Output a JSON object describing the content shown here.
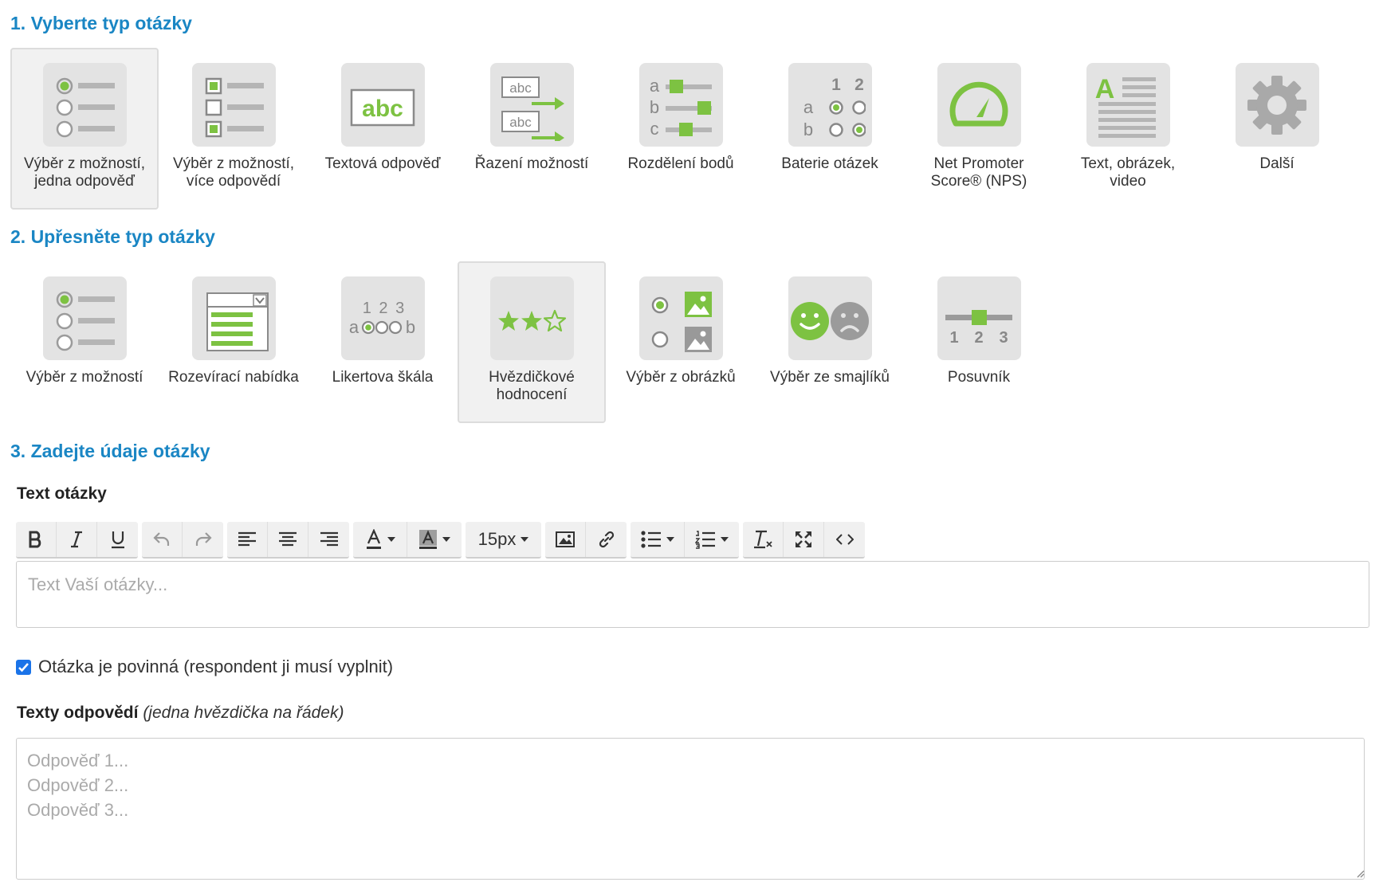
{
  "sections": {
    "s1": "1. Vyberte typ otázky",
    "s2": "2. Upřesněte typ otázky",
    "s3": "3. Zadejte údaje otázky"
  },
  "question_types": [
    {
      "label": "Výběr z možností,\njedna odpověď",
      "icon": "single-choice-icon",
      "selected": true
    },
    {
      "label": "Výběr z možností,\nvíce odpovědí",
      "icon": "multiple-choice-icon"
    },
    {
      "label": "Textová odpověď",
      "icon": "text-answer-icon"
    },
    {
      "label": "Řazení možností",
      "icon": "ordering-icon"
    },
    {
      "label": "Rozdělení bodů",
      "icon": "points-distribution-icon"
    },
    {
      "label": "Baterie otázek",
      "icon": "question-battery-icon"
    },
    {
      "label": "Net Promoter\nScore® (NPS)",
      "icon": "gauge-icon"
    },
    {
      "label": "Text, obrázek,\nvideo",
      "icon": "text-image-video-icon"
    },
    {
      "label": "Další",
      "icon": "gear-icon"
    }
  ],
  "subtypes": [
    {
      "label": "Výběr z možností",
      "icon": "radio-list-icon"
    },
    {
      "label": "Rozevírací nabídka",
      "icon": "dropdown-icon"
    },
    {
      "label": "Likertova škála",
      "icon": "likert-scale-icon"
    },
    {
      "label": "Hvězdičkové\nhodnocení",
      "icon": "star-rating-icon",
      "selected": true
    },
    {
      "label": "Výběr z obrázků",
      "icon": "image-choice-icon"
    },
    {
      "label": "Výběr ze smajlíků",
      "icon": "smiley-icon"
    },
    {
      "label": "Posuvník",
      "icon": "slider-icon"
    }
  ],
  "icon_texts": {
    "abc": "abc",
    "a": "a",
    "b": "b",
    "c": "c",
    "n1": "1",
    "n2": "2",
    "n3": "3",
    "likert_digits": "1 2 3",
    "A": "A"
  },
  "question_text": {
    "label": "Text otázky",
    "placeholder": "Text Vaší otázky...",
    "font_size": "15px"
  },
  "toolbar_buttons": [
    "bold-icon",
    "italic-icon",
    "underline-icon",
    "undo-icon",
    "redo-icon",
    "align-left-icon",
    "align-center-icon",
    "align-right-icon",
    "text-color-icon",
    "background-color-icon",
    "font-size-select",
    "image-icon",
    "link-icon",
    "bullet-list-icon",
    "numbered-list-icon",
    "clear-format-icon",
    "fullscreen-icon",
    "code-view-icon"
  ],
  "required": {
    "label": "Otázka je povinná (respondent ji musí vyplnit)",
    "checked": true
  },
  "answers": {
    "label": "Texty odpovědí",
    "hint": "(jedna hvězdička na řádek)",
    "placeholder": "Odpověď 1...\nOdpověď 2...\nOdpověď 3..."
  },
  "colors": {
    "accent": "#1a86c4",
    "green": "#7dc242",
    "icon_gray": "#b5b5b5",
    "tile_bg": "#e3e3e3",
    "checkbox": "#1a73e8"
  }
}
